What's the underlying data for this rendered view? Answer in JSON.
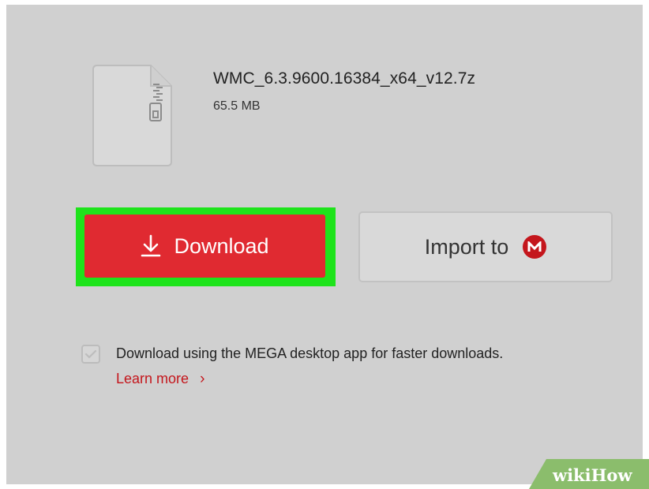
{
  "file": {
    "name": "WMC_6.3.9600.16384_x64_v12.7z",
    "size": "65.5 MB",
    "icon": "zip-file-icon"
  },
  "actions": {
    "download_label": "Download",
    "download_icon": "download-arrow-icon",
    "import_label": "Import to",
    "import_icon": "mega-logo-icon",
    "import_icon_letter": "M"
  },
  "desktop_app": {
    "checked": true,
    "text": "Download using the MEGA desktop app for faster downloads.",
    "learn_more": "Learn more",
    "learn_more_chevron": "›"
  },
  "watermark": {
    "wiki": "wiki",
    "how": "How"
  },
  "colors": {
    "accent_red": "#e02a31",
    "mega_red": "#c4161c",
    "highlight_green": "#1ee31b",
    "panel_gray": "#d0d0d0",
    "watermark_green": "#8bbd6c"
  }
}
